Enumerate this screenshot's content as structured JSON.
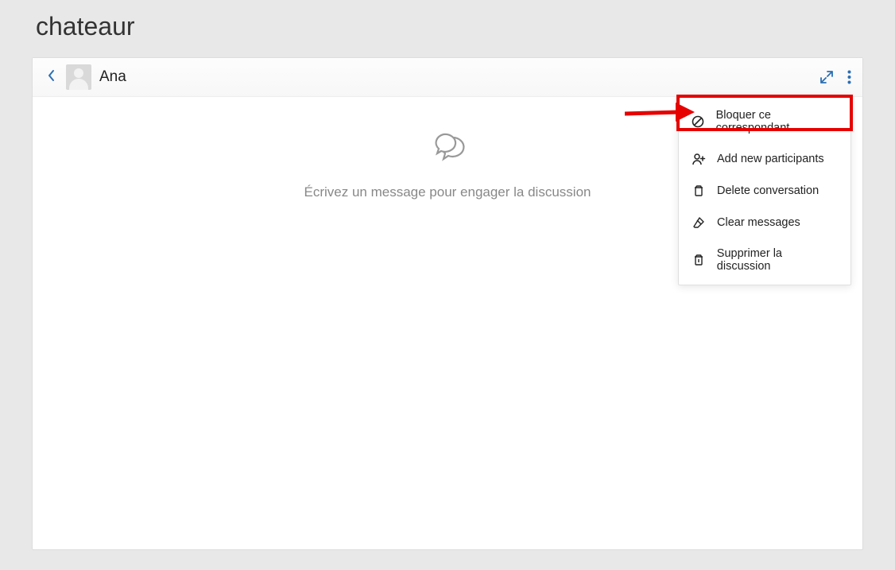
{
  "page": {
    "title": "chateaur"
  },
  "header": {
    "contact_name": "Ana"
  },
  "empty_state": {
    "message": "Écrivez un message pour engager la discussion"
  },
  "menu": {
    "items": [
      {
        "label": "Bloquer ce correspondant"
      },
      {
        "label": "Add new participants"
      },
      {
        "label": "Delete conversation"
      },
      {
        "label": "Clear messages"
      },
      {
        "label": "Supprimer la discussion"
      }
    ]
  }
}
